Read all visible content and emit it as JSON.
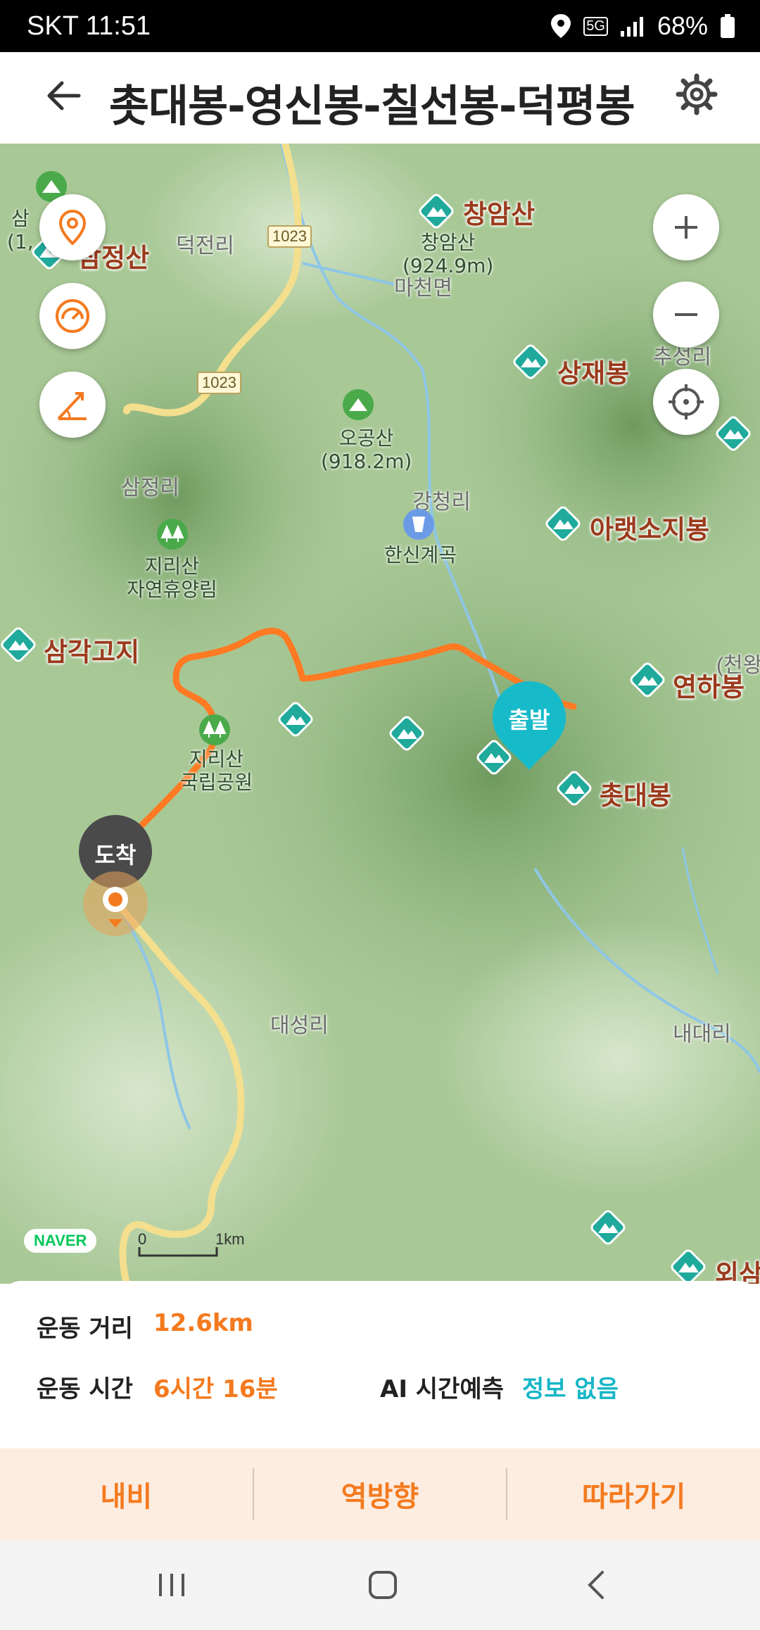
{
  "status_bar": {
    "carrier_time": "SKT 11:51",
    "battery": "68%",
    "network": "5G"
  },
  "header": {
    "title": "촛대봉-영신봉-칠선봉-덕평봉"
  },
  "map": {
    "peaks": [
      {
        "name": "창암산"
      },
      {
        "name": "상재봉"
      },
      {
        "name": "아랫소지봉"
      },
      {
        "name": "삼각고지"
      },
      {
        "name": "연하봉"
      },
      {
        "name": "촛대봉"
      },
      {
        "name": "외삼"
      },
      {
        "name": "삼정산"
      }
    ],
    "places": [
      {
        "name": "덕전리"
      },
      {
        "name": "마천면"
      },
      {
        "name": "추성리"
      },
      {
        "name": "삼정리"
      },
      {
        "name": "강청리"
      },
      {
        "name": "대성리"
      },
      {
        "name": "내대리"
      },
      {
        "name": "(천왕"
      }
    ],
    "pois": [
      {
        "name": "창암산\n(924.9m)"
      },
      {
        "name": "오공산\n(918.2m)"
      },
      {
        "name": "지리산\n자연휴양림"
      },
      {
        "name": "한신계곡"
      },
      {
        "name": "지리산\n국립공원"
      },
      {
        "name": "삼\n(1,"
      }
    ],
    "roads": [
      "1023",
      "1023"
    ],
    "start_marker": "출발",
    "end_marker": "도착",
    "scale": {
      "zero": "0",
      "unit": "1km"
    },
    "logo": "NAVER"
  },
  "stats": {
    "distance_label": "운동 거리",
    "distance_value": "12.6km",
    "time_label": "운동 시간",
    "time_value": "6시간 16분",
    "ai_label": "AI 시간예측",
    "ai_value": "정보 없음"
  },
  "actions": {
    "nav": "내비",
    "reverse": "역방향",
    "follow": "따라가기"
  },
  "colors": {
    "accent": "#f47a1f",
    "route": "#ff7a22",
    "start_marker": "#17bac9",
    "info_blue": "#16b6c6"
  }
}
